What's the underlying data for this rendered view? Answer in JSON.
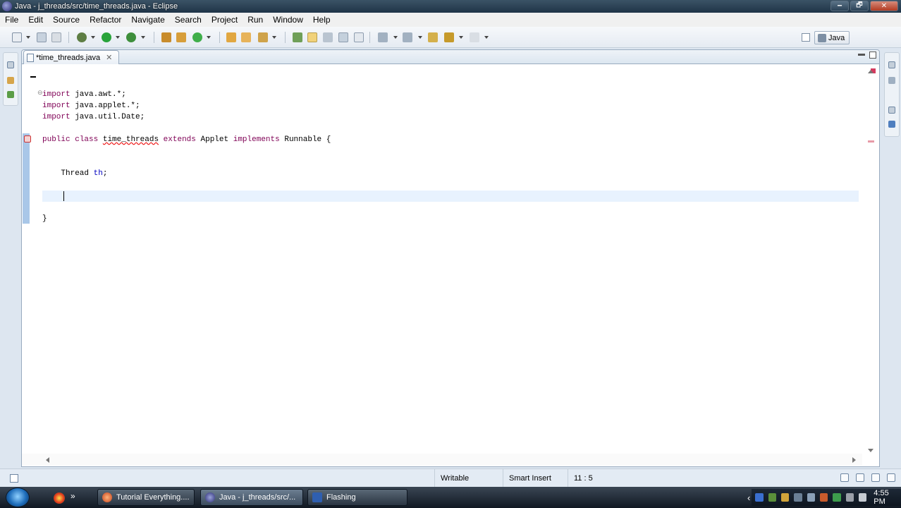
{
  "window": {
    "title": "Java - j_threads/src/time_threads.java - Eclipse",
    "controls": {
      "minimize": "🗕",
      "maximize": "🗗",
      "close": "✕"
    }
  },
  "menu": [
    "File",
    "Edit",
    "Source",
    "Refactor",
    "Navigate",
    "Search",
    "Project",
    "Run",
    "Window",
    "Help"
  ],
  "perspective": {
    "label": "Java"
  },
  "editor": {
    "tab_label": "*time_threads.java",
    "tab_close": "✕",
    "code": {
      "import_kw": "import",
      "import1_rest": " java.awt.*;",
      "import2_rest": " java.applet.*;",
      "import3_rest": " java.util.Date;",
      "public_kw": "public",
      "class_kw": "class",
      "class_name": "time_threads",
      "extends_kw": "extends",
      "superclass": "Applet",
      "implements_kw": "implements",
      "interface_name": "Runnable",
      "open_brace": "{",
      "field_type": "Thread",
      "field_name": "th",
      "semicolon": ";",
      "close_brace": "}"
    },
    "fold_marker": "⊖"
  },
  "status": {
    "writable": "Writable",
    "insert_mode": "Smart Insert",
    "position": "11 : 5"
  },
  "taskbar": {
    "buttons": [
      {
        "label": "Tutorial Everything...."
      },
      {
        "label": "Java - j_threads/src/..."
      },
      {
        "label": "Flashing"
      }
    ],
    "quick_launch_more": "»",
    "tray_arrow": "‹",
    "clock": "4:55 PM"
  },
  "colors": {
    "keyword": "#7f0055",
    "field": "#0000c0",
    "error_underline": "#ee1111",
    "current_line": "#e8f2fe"
  }
}
